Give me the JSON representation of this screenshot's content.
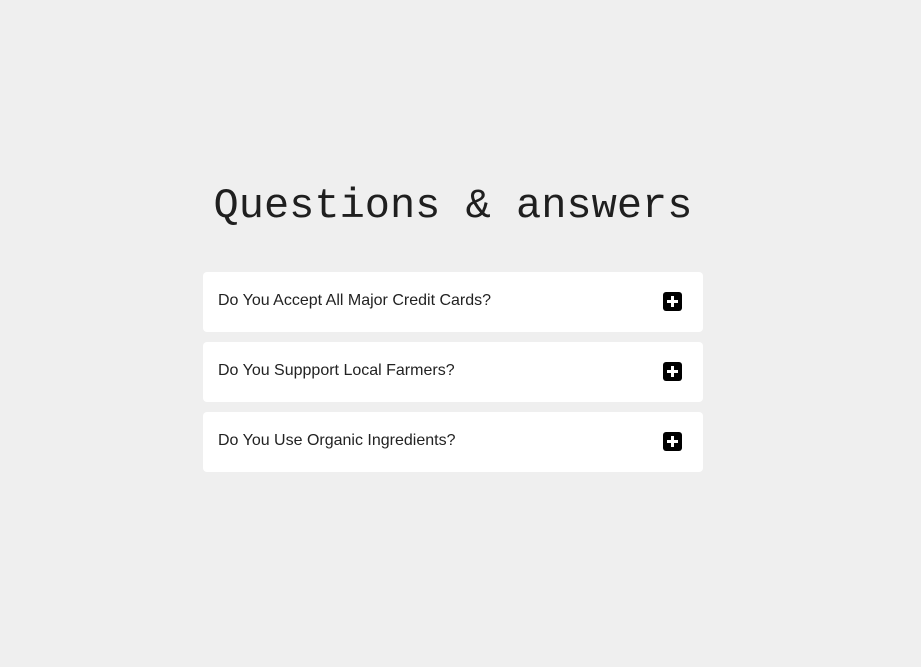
{
  "page": {
    "title": "Questions & answers"
  },
  "faq": {
    "items": [
      {
        "question": "Do You Accept All Major Credit Cards?",
        "icon": "plus-square-icon"
      },
      {
        "question": "Do You Suppport Local Farmers?",
        "icon": "plus-square-icon"
      },
      {
        "question": "Do You Use Organic Ingredients?",
        "icon": "plus-square-icon"
      }
    ]
  },
  "colors": {
    "background": "#efefef",
    "card": "#ffffff",
    "text": "#222222",
    "icon": "#000000"
  }
}
